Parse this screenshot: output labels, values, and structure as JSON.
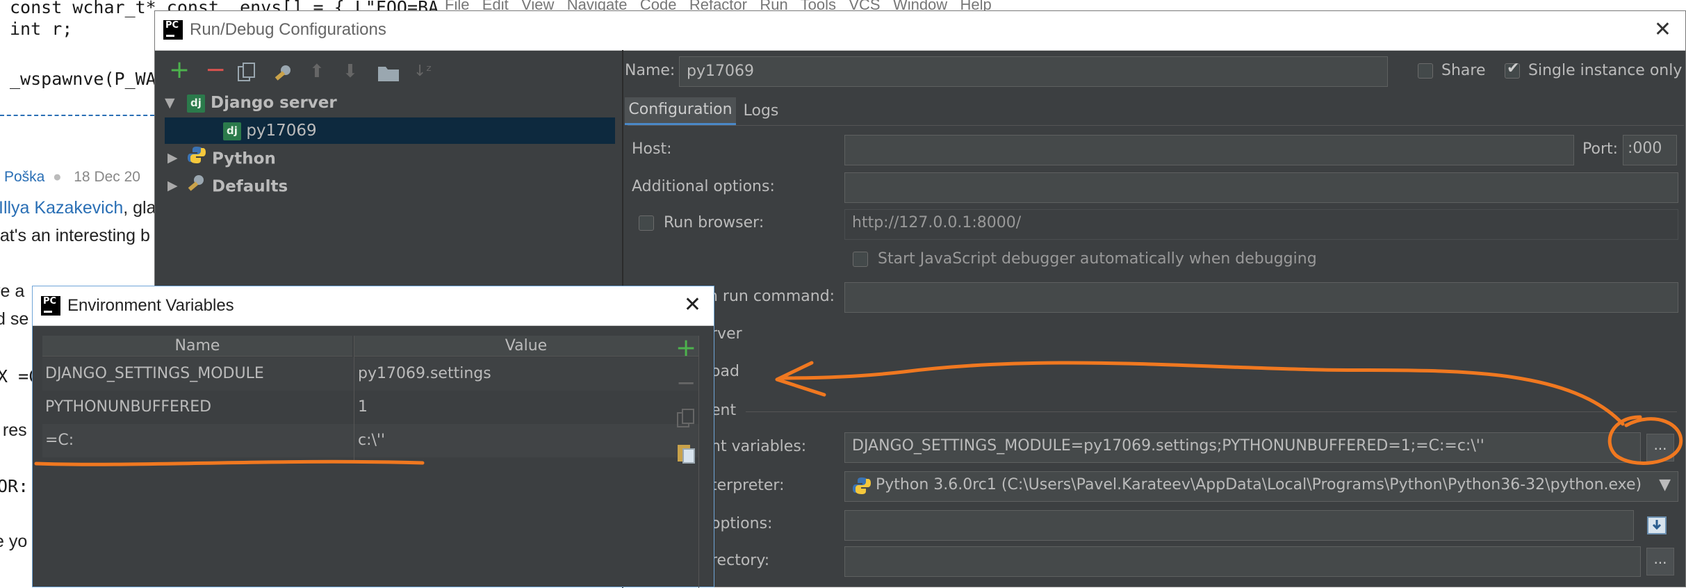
{
  "background": {
    "code_lines": [
      "const wchar_t* const _envs[] = { L\"FOO=BA",
      "int r;",
      "_wspawnve(P_WA"
    ],
    "menu": [
      "File",
      "Edit",
      "View",
      "Navigate",
      "Code",
      "Refactor",
      "Run",
      "Tools",
      "VCS",
      "Window",
      "Help"
    ],
    "comment_author": "Poška",
    "comment_date": "18 Dec 20",
    "reply_link": "Illya Kazakevich",
    "reply_text": ", gla",
    "text_lines": [
      "hat's an interesting b",
      "ve a",
      "d se",
      "X =C",
      "t res",
      "OR:",
      "e yo"
    ]
  },
  "run_debug_dialog": {
    "title": "Run/Debug Configurations",
    "tree": {
      "django_server": "Django server",
      "py17069": "py17069",
      "python": "Python",
      "defaults": "Defaults"
    },
    "name_label": "Name:",
    "name_value": "py17069",
    "share_label": "Share",
    "single_instance_label": "Single instance only",
    "tabs": [
      "Configuration",
      "Logs"
    ],
    "host_label": "Host:",
    "port_label": "Port:",
    "port_value": ":000",
    "additional_options_label": "Additional options:",
    "run_browser_label": "Run browser:",
    "run_browser_url": "http://127.0.0.1:8000/",
    "js_debugger_label": "Start JavaScript debugger automatically when debugging",
    "custom_run_command_label": "n run command:",
    "rver_label": "rver",
    "reload_label": "oad",
    "env_section_label": "ent",
    "env_vars_label": "nt variables:",
    "env_vars_value": "DJANGO_SETTINGS_MODULE=py17069.settings;PYTHONUNBUFFERED=1;=C:=c:\\''",
    "interpreter_label": "terpreter:",
    "interpreter_value": "Python 3.6.0rc1 (C:\\Users\\Pavel.Karateev\\AppData\\Local\\Programs\\Python\\Python36-32\\python.exe)",
    "options_label": "options:",
    "directory_label": "rectory:"
  },
  "env_dialog": {
    "title": "Environment Variables",
    "columns": [
      "Name",
      "Value"
    ],
    "rows": [
      {
        "name": "DJANGO_SETTINGS_MODULE",
        "value": "py17069.settings"
      },
      {
        "name": "PYTHONUNBUFFERED",
        "value": "1"
      },
      {
        "name": "=C:",
        "value": "c:\\''"
      }
    ]
  },
  "colors": {
    "dialog_bg": "#3c3f41",
    "field_bg": "#45494a",
    "selection": "#0d293e",
    "annotation": "#f07820",
    "add_green": "#4db34d",
    "remove_red": "#d9534f"
  }
}
